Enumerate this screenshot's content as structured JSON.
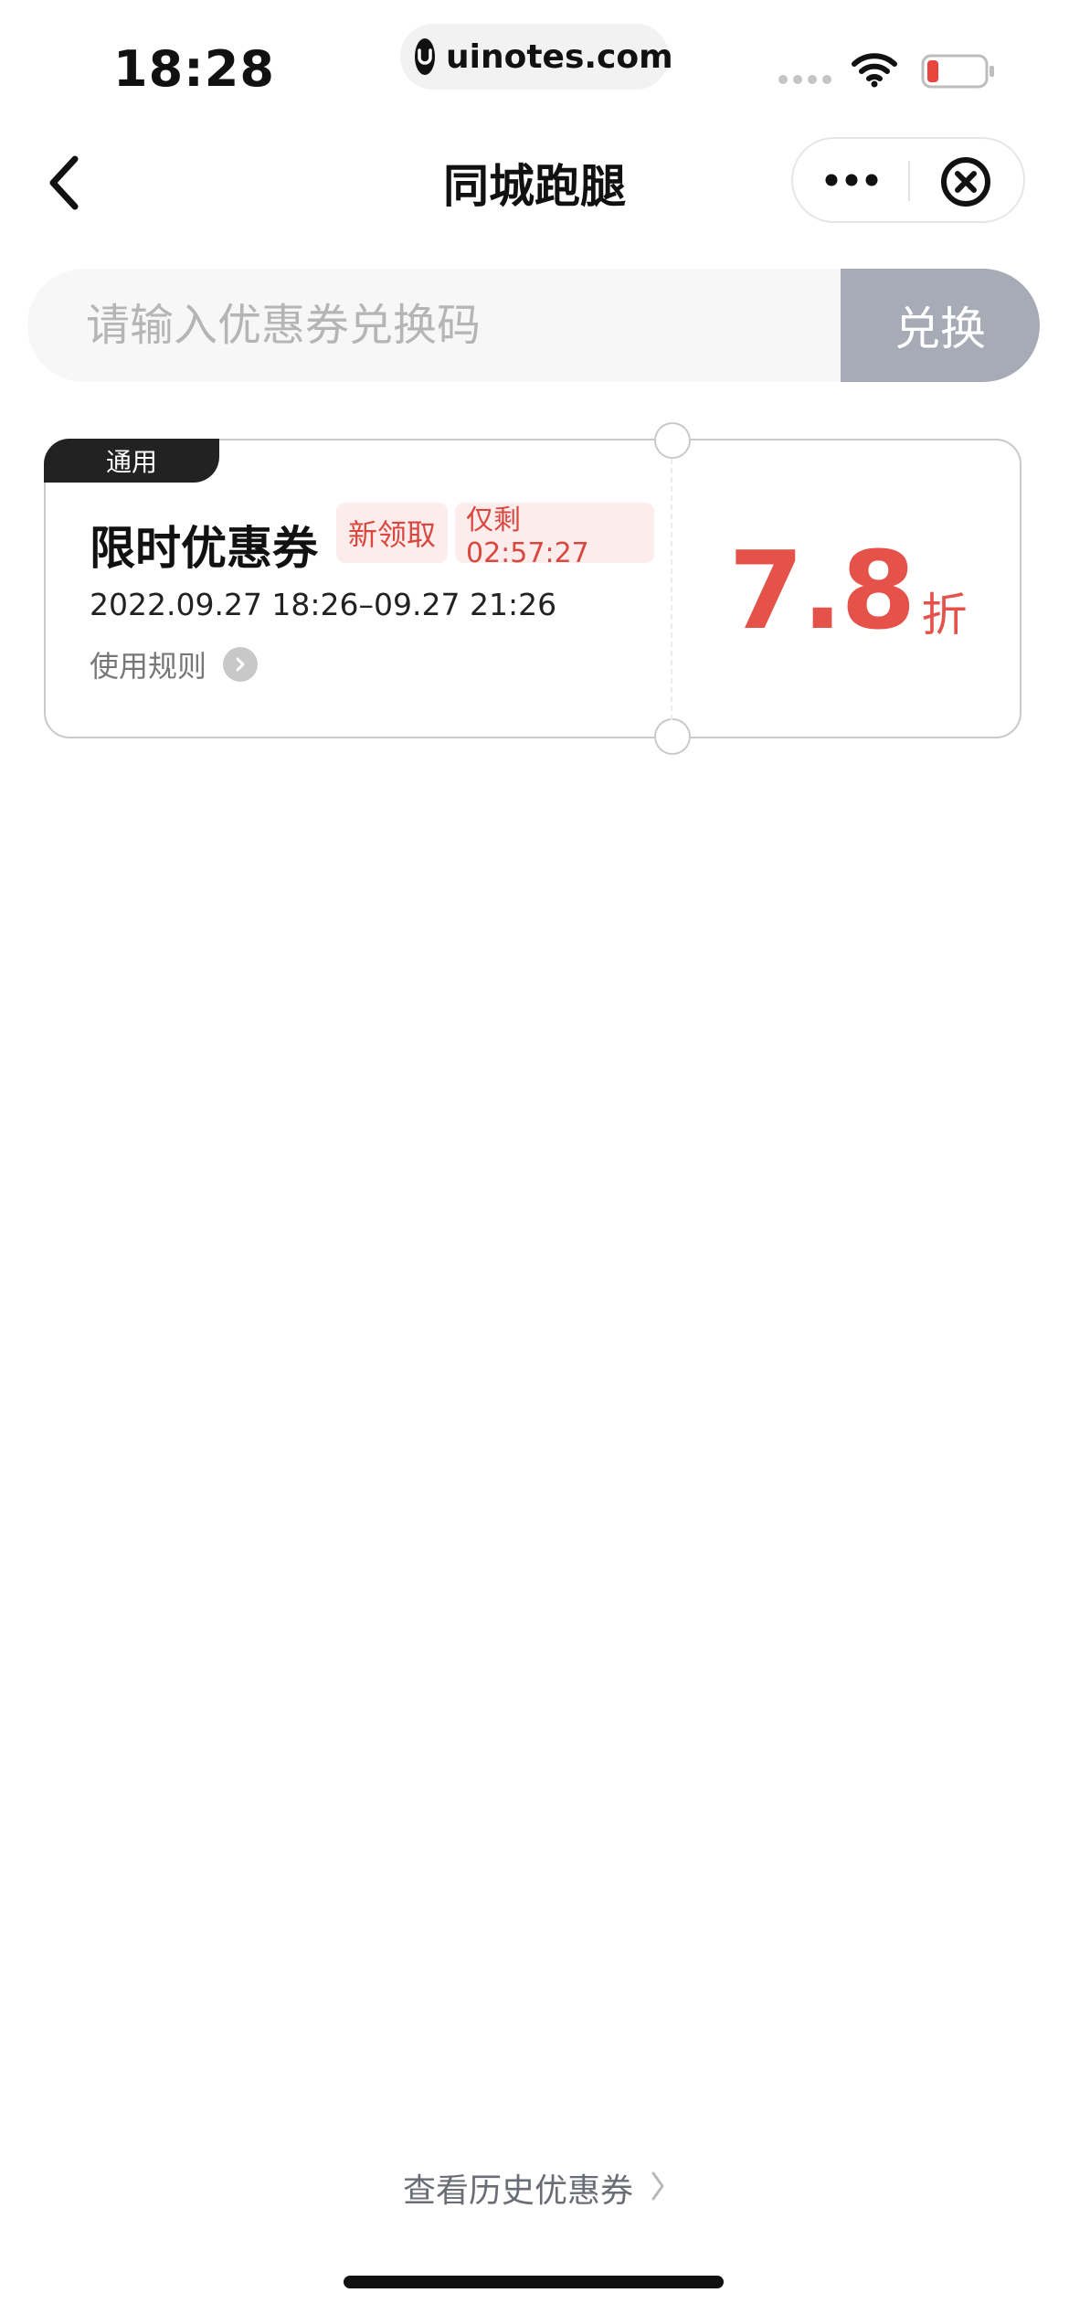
{
  "status_bar": {
    "time": "18:28",
    "url": "uinotes.com",
    "battery_color": "#e8453c"
  },
  "nav": {
    "title": "同城跑腿",
    "back_icon": "chevron-left-icon",
    "more_icon": "more-dots-icon",
    "close_icon": "close-circle-icon"
  },
  "redeem": {
    "placeholder": "请输入优惠券兑换码",
    "value": "",
    "button_label": "兑换",
    "button_color": "#a7abb5"
  },
  "coupons": [
    {
      "tag": "通用",
      "title": "限时优惠券",
      "badge_new": "新领取",
      "badge_timer": "仅剩02:57:27",
      "valid_period": "2022.09.27 18:26–09.27 21:26",
      "rules_label": "使用规则",
      "discount_value": "7.8",
      "discount_unit": "折",
      "accent_color": "#e5524a"
    }
  ],
  "footer": {
    "history_link": "查看历史优惠券"
  }
}
